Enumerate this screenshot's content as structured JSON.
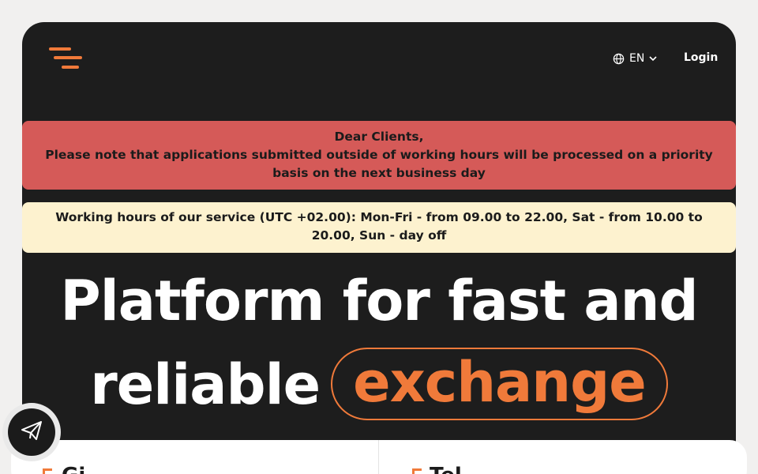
{
  "header": {
    "language": "EN",
    "login_label": "Login"
  },
  "notices": {
    "priority_title": "Dear Clients,",
    "priority_body": "Please note that applications submitted outside of working hours will be processed on a priority basis on the next business day",
    "working_hours": "Working hours of our service (UTC +02.00): Mon-Fri - from 09.00 to 22.00, Sat - from 10.00 to 20.00, Sun - day off"
  },
  "hero": {
    "line1": "Platform for fast and",
    "line2_plain": "reliable",
    "line2_highlight": "exchange"
  },
  "bottom": {
    "left_text": "Gi",
    "right_text": "Tel"
  },
  "icons": {
    "menu": "menu-icon",
    "language": "globe-icon",
    "dropdown": "chevron-down-icon",
    "contact": "paper-plane-icon"
  },
  "colors": {
    "accent": "#f07a3a",
    "dark": "#1d1d1d",
    "notice_red": "#d55a58",
    "notice_yellow": "#fdf2cf"
  }
}
